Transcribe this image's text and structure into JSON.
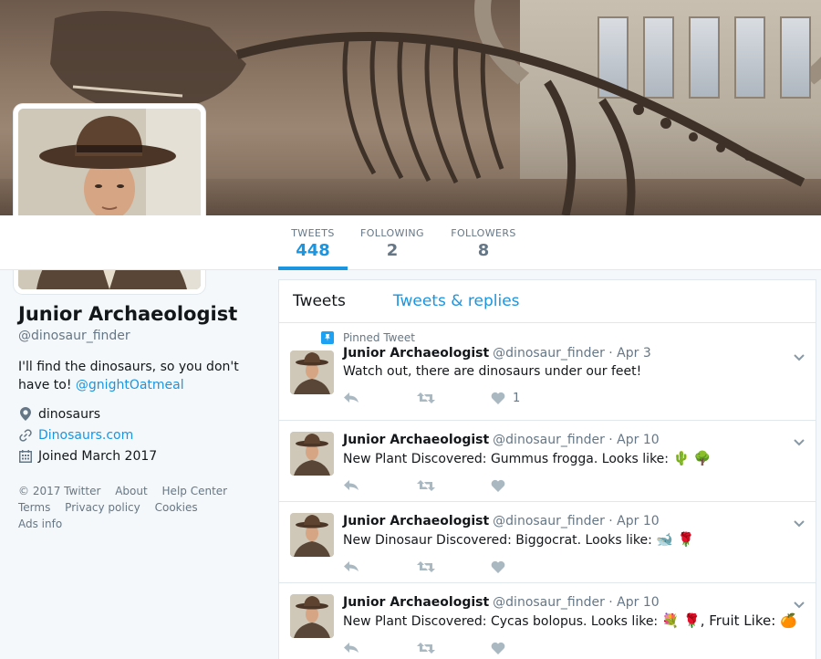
{
  "profile": {
    "name": "Junior Archaeologist",
    "handle": "@dinosaur_finder",
    "bio_text": "I'll find the dinosaurs, so you don't have to!",
    "bio_mention": "@gnightOatmeal",
    "location": "dinosaurs",
    "website": "Dinosaurs.com",
    "joined": "Joined March 2017"
  },
  "stats": [
    {
      "label": "TWEETS",
      "value": "448"
    },
    {
      "label": "FOLLOWING",
      "value": "2"
    },
    {
      "label": "FOLLOWERS",
      "value": "8"
    }
  ],
  "footer": {
    "copyright": "© 2017 Twitter",
    "about": "About",
    "help": "Help Center",
    "terms": "Terms",
    "privacy": "Privacy policy",
    "cookies": "Cookies",
    "ads": "Ads info"
  },
  "tabs": {
    "tweets": "Tweets",
    "replies": "Tweets & replies"
  },
  "pinned_label": "Pinned Tweet",
  "tweets": [
    {
      "name": "Junior Archaeologist",
      "handle": "@dinosaur_finder · Apr 3",
      "text": "Watch out, there are dinosaurs under our feet!",
      "emoji": "",
      "likes": "1"
    },
    {
      "name": "Junior Archaeologist",
      "handle": "@dinosaur_finder · Apr 10",
      "text": "New Plant Discovered: Gummus frogga. Looks like: ",
      "emoji": "🌵 🌳",
      "likes": ""
    },
    {
      "name": "Junior Archaeologist",
      "handle": "@dinosaur_finder · Apr 10",
      "text": "New Dinosaur Discovered: Biggocrat. Looks like: ",
      "emoji": "🐋 🌹",
      "likes": ""
    },
    {
      "name": "Junior Archaeologist",
      "handle": "@dinosaur_finder · Apr 10",
      "text": "New Plant Discovered: Cycas bolopus. Looks like: ",
      "emoji": "💐 🌹, Fruit Like: 🍊",
      "likes": ""
    }
  ],
  "colors": {
    "accent": "#1b95e0",
    "muted": "#657786",
    "icon": "#aab8c2"
  },
  "icons": {
    "location": "map-pin-icon",
    "website": "link-icon",
    "joined": "calendar-icon",
    "reply": "reply-icon",
    "retweet": "retweet-icon",
    "like": "heart-icon",
    "caret": "chevron-down-icon",
    "pinned": "pin-icon"
  }
}
